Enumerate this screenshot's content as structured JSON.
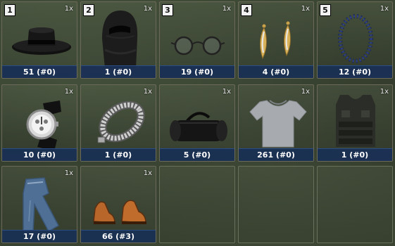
{
  "inventory": {
    "slots": [
      {
        "hotkey": "1",
        "qty": "1x",
        "label": "51 (#0)",
        "icon": "hat-icon"
      },
      {
        "hotkey": "2",
        "qty": "1x",
        "label": "1 (#0)",
        "icon": "balaclava-icon"
      },
      {
        "hotkey": "3",
        "qty": "1x",
        "label": "19 (#0)",
        "icon": "glasses-icon"
      },
      {
        "hotkey": "4",
        "qty": "1x",
        "label": "4 (#0)",
        "icon": "earrings-icon"
      },
      {
        "hotkey": "5",
        "qty": "1x",
        "label": "12 (#0)",
        "icon": "bead-necklace-icon"
      },
      {
        "hotkey": "",
        "qty": "1x",
        "label": "10 (#0)",
        "icon": "wristwatch-icon"
      },
      {
        "hotkey": "",
        "qty": "1x",
        "label": "1 (#0)",
        "icon": "chain-bracelet-icon"
      },
      {
        "hotkey": "",
        "qty": "1x",
        "label": "5 (#0)",
        "icon": "duffel-bag-icon"
      },
      {
        "hotkey": "",
        "qty": "1x",
        "label": "261 (#0)",
        "icon": "tshirt-icon"
      },
      {
        "hotkey": "",
        "qty": "1x",
        "label": "1 (#0)",
        "icon": "body-armor-icon"
      },
      {
        "hotkey": "",
        "qty": "1x",
        "label": "17 (#0)",
        "icon": "jeans-icon"
      },
      {
        "hotkey": "",
        "qty": "1x",
        "label": "66 (#3)",
        "icon": "shoes-icon"
      }
    ]
  },
  "colors": {
    "caption_bg": "#193056",
    "slot_border": "#6b6a58",
    "hotkey_bg": "#f2f2f2"
  }
}
